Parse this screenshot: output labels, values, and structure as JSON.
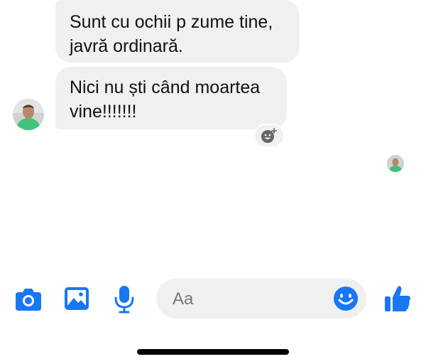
{
  "messages": [
    {
      "lines": [
        "Sunt cu ochii p zume tine,",
        "javră ordinară."
      ]
    },
    {
      "lines": [
        "Nici nu ști când moartea",
        "vine!!!!!!!"
      ]
    }
  ],
  "composer": {
    "placeholder": "Aa"
  },
  "icons": {
    "camera": "camera-icon",
    "gallery": "image-icon",
    "mic": "microphone-icon",
    "emoji": "smiley-icon",
    "like": "thumbs-up-icon",
    "react": "add-reaction-icon"
  },
  "colors": {
    "accent": "#1877f2",
    "bubble": "#f0f0f0",
    "text": "#111111",
    "placeholder": "#777777"
  }
}
